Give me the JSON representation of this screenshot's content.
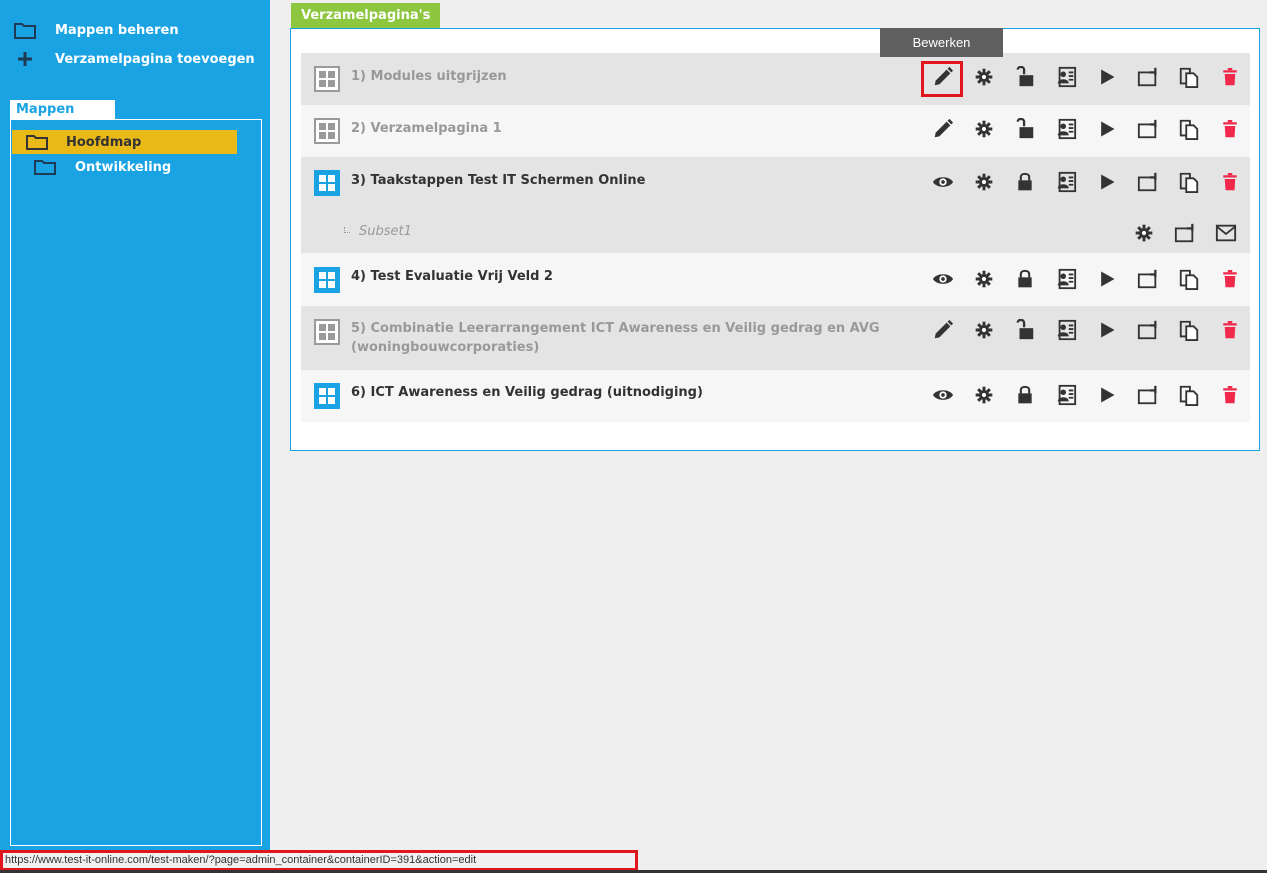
{
  "sidebar": {
    "actions": [
      {
        "label": "Mappen beheren",
        "icon": "folder-icon"
      },
      {
        "label": "Verzamelpagina toevoegen",
        "icon": "plus-icon"
      }
    ],
    "folders_tab": "Mappen",
    "folders": [
      {
        "label": "Hoofdmap",
        "selected": true
      },
      {
        "label": "Ontwikkeling",
        "selected": false
      }
    ]
  },
  "main": {
    "tab": "Verzamelpagina's",
    "tooltip": "Bewerken",
    "rows": [
      {
        "title": "1) Modules uitgrijzen",
        "state": "inactive",
        "first_icon": "pencil-icon",
        "lock": "unlocked"
      },
      {
        "title": "2) Verzamelpagina 1",
        "state": "inactive",
        "first_icon": "pencil-icon",
        "lock": "unlocked"
      },
      {
        "title": "3) Taakstappen Test IT Schermen Online",
        "state": "active",
        "first_icon": "eye-icon",
        "lock": "locked"
      },
      {
        "title": "4) Test Evaluatie Vrij Veld 2",
        "state": "active",
        "first_icon": "eye-icon",
        "lock": "locked"
      },
      {
        "title": "5) Combinatie Leerarrangement ICT Awareness en Veilig gedrag en AVG",
        "title_line2": "(woningbouwcorporaties)",
        "state": "inactive",
        "first_icon": "pencil-icon",
        "lock": "unlocked"
      },
      {
        "title": "6) ICT Awareness en Veilig gedrag (uitnodiging)",
        "state": "active",
        "first_icon": "eye-icon",
        "lock": "locked"
      }
    ],
    "subset": {
      "label": "Subset1"
    }
  },
  "statusbar": {
    "url": "https://www.test-it-online.com/test-maken/?page=admin_container&containerID=391&action=edit"
  },
  "colors": {
    "sidebar": "#1aa3e3",
    "selected_folder": "#e8b917",
    "tab_green": "#8dc63f",
    "delete_red": "#f0284a",
    "highlight_red": "#e0151d"
  }
}
